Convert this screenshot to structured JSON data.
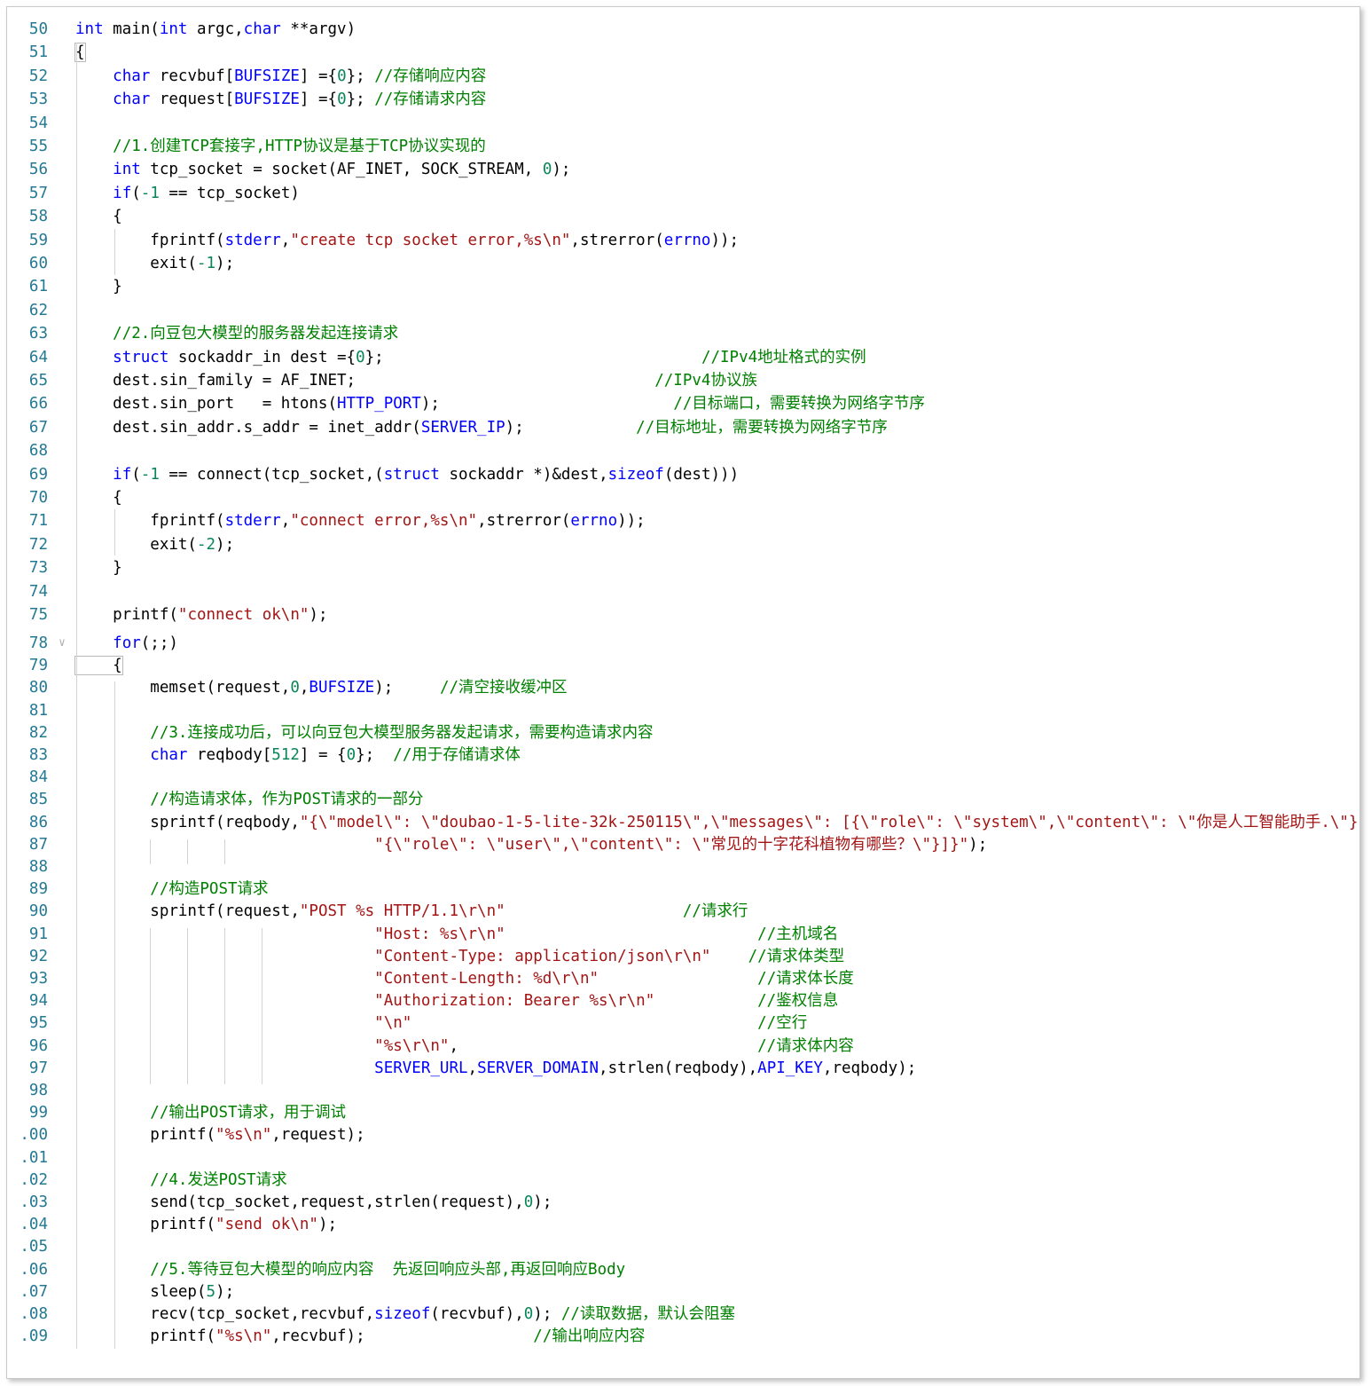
{
  "editor": {
    "lines": [
      {
        "n": "50",
        "seg": [
          [
            "kw",
            "int"
          ],
          [
            "t",
            " main("
          ],
          [
            "kw",
            "int"
          ],
          [
            "t",
            " argc,"
          ],
          [
            "kw",
            "char"
          ],
          [
            "t",
            " **argv)"
          ]
        ]
      },
      {
        "n": "51",
        "seg": [
          [
            "t",
            "{"
          ]
        ]
      },
      {
        "n": "52",
        "seg": [
          [
            "t",
            "    "
          ],
          [
            "kw",
            "char"
          ],
          [
            "t",
            " recvbuf["
          ],
          [
            "mac",
            "BUFSIZE"
          ],
          [
            "t",
            "] ={"
          ],
          [
            "num",
            "0"
          ],
          [
            "t",
            "}; "
          ],
          [
            "com",
            "//存储响应内容"
          ]
        ]
      },
      {
        "n": "53",
        "seg": [
          [
            "t",
            "    "
          ],
          [
            "kw",
            "char"
          ],
          [
            "t",
            " request["
          ],
          [
            "mac",
            "BUFSIZE"
          ],
          [
            "t",
            "] ={"
          ],
          [
            "num",
            "0"
          ],
          [
            "t",
            "}; "
          ],
          [
            "com",
            "//存储请求内容"
          ]
        ]
      },
      {
        "n": "54",
        "seg": []
      },
      {
        "n": "55",
        "seg": [
          [
            "t",
            "    "
          ],
          [
            "com",
            "//1.创建TCP套接字,HTTP协议是基于TCP协议实现的"
          ]
        ]
      },
      {
        "n": "56",
        "seg": [
          [
            "t",
            "    "
          ],
          [
            "kw",
            "int"
          ],
          [
            "t",
            " tcp_socket = socket(AF_INET, SOCK_STREAM, "
          ],
          [
            "num",
            "0"
          ],
          [
            "t",
            ");"
          ]
        ]
      },
      {
        "n": "57",
        "seg": [
          [
            "t",
            "    "
          ],
          [
            "kw",
            "if"
          ],
          [
            "t",
            "("
          ],
          [
            "num",
            "-1"
          ],
          [
            "t",
            " == tcp_socket)"
          ]
        ]
      },
      {
        "n": "58",
        "seg": [
          [
            "t",
            "    {"
          ]
        ]
      },
      {
        "n": "59",
        "seg": [
          [
            "t",
            "        fprintf("
          ],
          [
            "mac",
            "stderr"
          ],
          [
            "t",
            ","
          ],
          [
            "str",
            "\"create tcp socket error,%s\\n\""
          ],
          [
            "t",
            ",strerror("
          ],
          [
            "mac",
            "errno"
          ],
          [
            "t",
            "));"
          ]
        ]
      },
      {
        "n": "60",
        "seg": [
          [
            "t",
            "        exit("
          ],
          [
            "num",
            "-1"
          ],
          [
            "t",
            ");"
          ]
        ]
      },
      {
        "n": "61",
        "seg": [
          [
            "t",
            "    }"
          ]
        ]
      },
      {
        "n": "62",
        "seg": []
      },
      {
        "n": "63",
        "seg": [
          [
            "t",
            "    "
          ],
          [
            "com",
            "//2.向豆包大模型的服务器发起连接请求"
          ]
        ]
      },
      {
        "n": "64",
        "seg": [
          [
            "t",
            "    "
          ],
          [
            "kw",
            "struct"
          ],
          [
            "t",
            " sockaddr_in dest ={"
          ],
          [
            "num",
            "0"
          ],
          [
            "t",
            "};                                  "
          ],
          [
            "com",
            "//IPv4地址格式的实例"
          ]
        ]
      },
      {
        "n": "65",
        "seg": [
          [
            "t",
            "    dest.sin_family = AF_INET;                                "
          ],
          [
            "com",
            "//IPv4协议族"
          ]
        ]
      },
      {
        "n": "66",
        "seg": [
          [
            "t",
            "    dest.sin_port   = htons("
          ],
          [
            "mac",
            "HTTP_PORT"
          ],
          [
            "t",
            ");                         "
          ],
          [
            "com",
            "//目标端口，需要转换为网络字节序"
          ]
        ]
      },
      {
        "n": "67",
        "seg": [
          [
            "t",
            "    dest.sin_addr.s_addr = inet_addr("
          ],
          [
            "mac",
            "SERVER_IP"
          ],
          [
            "t",
            ");            "
          ],
          [
            "com",
            "//目标地址，需要转换为网络字节序"
          ]
        ]
      },
      {
        "n": "68",
        "seg": []
      },
      {
        "n": "69",
        "seg": [
          [
            "t",
            "    "
          ],
          [
            "kw",
            "if"
          ],
          [
            "t",
            "("
          ],
          [
            "num",
            "-1"
          ],
          [
            "t",
            " == connect(tcp_socket,("
          ],
          [
            "kw",
            "struct"
          ],
          [
            "t",
            " sockaddr *)&dest,"
          ],
          [
            "kw",
            "sizeof"
          ],
          [
            "t",
            "(dest)))"
          ]
        ]
      },
      {
        "n": "70",
        "seg": [
          [
            "t",
            "    {"
          ]
        ]
      },
      {
        "n": "71",
        "seg": [
          [
            "t",
            "        fprintf("
          ],
          [
            "mac",
            "stderr"
          ],
          [
            "t",
            ","
          ],
          [
            "str",
            "\"connect error,%s\\n\""
          ],
          [
            "t",
            ",strerror("
          ],
          [
            "mac",
            "errno"
          ],
          [
            "t",
            "));"
          ]
        ]
      },
      {
        "n": "72",
        "seg": [
          [
            "t",
            "        exit("
          ],
          [
            "num",
            "-2"
          ],
          [
            "t",
            ");"
          ]
        ]
      },
      {
        "n": "73",
        "seg": [
          [
            "t",
            "    }"
          ]
        ]
      },
      {
        "n": "74",
        "seg": []
      },
      {
        "n": "75",
        "seg": [
          [
            "t",
            "    printf("
          ],
          [
            "str",
            "\"connect ok\\n\""
          ],
          [
            "t",
            ");"
          ]
        ]
      },
      {
        "n": "78",
        "seg": [
          [
            "t",
            "    "
          ],
          [
            "kw",
            "for"
          ],
          [
            "t",
            "(;;)"
          ]
        ]
      },
      {
        "n": "79",
        "seg": [
          [
            "t",
            "    {"
          ]
        ]
      },
      {
        "n": "80",
        "seg": [
          [
            "t",
            "        memset(request,"
          ],
          [
            "num",
            "0"
          ],
          [
            "t",
            ","
          ],
          [
            "mac",
            "BUFSIZE"
          ],
          [
            "t",
            ");     "
          ],
          [
            "com",
            "//清空接收缓冲区"
          ]
        ]
      },
      {
        "n": "81",
        "seg": []
      },
      {
        "n": "82",
        "seg": [
          [
            "t",
            "        "
          ],
          [
            "com",
            "//3.连接成功后，可以向豆包大模型服务器发起请求，需要构造请求内容"
          ]
        ]
      },
      {
        "n": "83",
        "seg": [
          [
            "t",
            "        "
          ],
          [
            "kw",
            "char"
          ],
          [
            "t",
            " reqbody["
          ],
          [
            "num",
            "512"
          ],
          [
            "t",
            "] = {"
          ],
          [
            "num",
            "0"
          ],
          [
            "t",
            "};  "
          ],
          [
            "com",
            "//用于存储请求体"
          ]
        ]
      },
      {
        "n": "84",
        "seg": []
      },
      {
        "n": "85",
        "seg": [
          [
            "t",
            "        "
          ],
          [
            "com",
            "//构造请求体，作为POST请求的一部分"
          ]
        ]
      },
      {
        "n": "86",
        "seg": [
          [
            "t",
            "        sprintf(reqbody,"
          ],
          [
            "str",
            "\"{\\\"model\\\": \\\"doubao-1-5-lite-32k-250115\\\",\\\"messages\\\": [{\\\"role\\\": \\\"system\\\",\\\"content\\\": \\\"你是人工智能助手.\\\"},"
          ]
        ]
      },
      {
        "n": "87",
        "seg": [
          [
            "t",
            "                                "
          ],
          [
            "str",
            "\"{\\\"role\\\": \\\"user\\\",\\\"content\\\": \\\"常见的十字花科植物有哪些？\\\"}]}\""
          ],
          [
            "t",
            ");"
          ]
        ]
      },
      {
        "n": "88",
        "seg": []
      },
      {
        "n": "89",
        "seg": [
          [
            "t",
            "        "
          ],
          [
            "com",
            "//构造POST请求"
          ]
        ]
      },
      {
        "n": "90",
        "seg": [
          [
            "t",
            "        sprintf(request,"
          ],
          [
            "str",
            "\"POST %s HTTP/1.1\\r\\n\""
          ],
          [
            "t",
            "                   "
          ],
          [
            "com",
            "//请求行"
          ]
        ]
      },
      {
        "n": "91",
        "seg": [
          [
            "t",
            "                                "
          ],
          [
            "str",
            "\"Host: %s\\r\\n\""
          ],
          [
            "t",
            "                           "
          ],
          [
            "com",
            "//主机域名"
          ]
        ]
      },
      {
        "n": "92",
        "seg": [
          [
            "t",
            "                                "
          ],
          [
            "str",
            "\"Content-Type: application/json\\r\\n\""
          ],
          [
            "t",
            "    "
          ],
          [
            "com",
            "//请求体类型"
          ]
        ]
      },
      {
        "n": "93",
        "seg": [
          [
            "t",
            "                                "
          ],
          [
            "str",
            "\"Content-Length: %d\\r\\n\""
          ],
          [
            "t",
            "                 "
          ],
          [
            "com",
            "//请求体长度"
          ]
        ]
      },
      {
        "n": "94",
        "seg": [
          [
            "t",
            "                                "
          ],
          [
            "str",
            "\"Authorization: Bearer %s\\r\\n\""
          ],
          [
            "t",
            "           "
          ],
          [
            "com",
            "//鉴权信息"
          ]
        ]
      },
      {
        "n": "95",
        "seg": [
          [
            "t",
            "                                "
          ],
          [
            "str",
            "\"\\n\""
          ],
          [
            "t",
            "                                     "
          ],
          [
            "com",
            "//空行"
          ]
        ]
      },
      {
        "n": "96",
        "seg": [
          [
            "t",
            "                                "
          ],
          [
            "str",
            "\"%s\\r\\n\""
          ],
          [
            "t",
            ",                                "
          ],
          [
            "com",
            "//请求体内容"
          ]
        ]
      },
      {
        "n": "97",
        "seg": [
          [
            "t",
            "                                "
          ],
          [
            "mac",
            "SERVER_URL"
          ],
          [
            "t",
            ","
          ],
          [
            "mac",
            "SERVER_DOMAIN"
          ],
          [
            "t",
            ",strlen(reqbody),"
          ],
          [
            "mac",
            "API_KEY"
          ],
          [
            "t",
            ",reqbody);"
          ]
        ]
      },
      {
        "n": "98",
        "seg": []
      },
      {
        "n": "99",
        "seg": [
          [
            "t",
            "        "
          ],
          [
            "com",
            "//输出POST请求，用于调试"
          ]
        ]
      },
      {
        "n": ".00",
        "seg": [
          [
            "t",
            "        printf("
          ],
          [
            "str",
            "\"%s\\n\""
          ],
          [
            "t",
            ",request);"
          ]
        ]
      },
      {
        "n": ".01",
        "seg": []
      },
      {
        "n": ".02",
        "seg": [
          [
            "t",
            "        "
          ],
          [
            "com",
            "//4.发送POST请求"
          ]
        ]
      },
      {
        "n": ".03",
        "seg": [
          [
            "t",
            "        send(tcp_socket,request,strlen(request),"
          ],
          [
            "num",
            "0"
          ],
          [
            "t",
            ");"
          ]
        ]
      },
      {
        "n": ".04",
        "seg": [
          [
            "t",
            "        printf("
          ],
          [
            "str",
            "\"send ok\\n\""
          ],
          [
            "t",
            ");"
          ]
        ]
      },
      {
        "n": ".05",
        "seg": []
      },
      {
        "n": ".06",
        "seg": [
          [
            "t",
            "        "
          ],
          [
            "com",
            "//5.等待豆包大模型的响应内容  先返回响应头部,再返回响应Body"
          ]
        ]
      },
      {
        "n": ".07",
        "seg": [
          [
            "t",
            "        sleep("
          ],
          [
            "num",
            "5"
          ],
          [
            "t",
            ");"
          ]
        ]
      },
      {
        "n": ".08",
        "seg": [
          [
            "t",
            "        recv(tcp_socket,recvbuf,"
          ],
          [
            "kw",
            "sizeof"
          ],
          [
            "t",
            "(recvbuf),"
          ],
          [
            "num",
            "0"
          ],
          [
            "t",
            "); "
          ],
          [
            "com",
            "//读取数据，默认会阻塞"
          ]
        ]
      },
      {
        "n": ".09",
        "seg": [
          [
            "t",
            "        printf("
          ],
          [
            "str",
            "\"%s\\n\""
          ],
          [
            "t",
            ",recvbuf);                  "
          ],
          [
            "com",
            "//输出响应内容"
          ]
        ]
      }
    ]
  }
}
